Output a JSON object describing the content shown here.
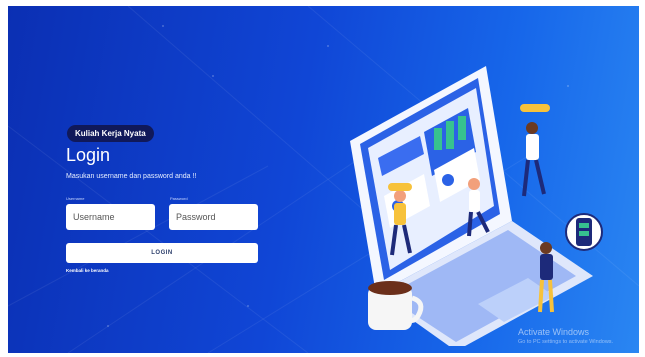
{
  "badge": "Kuliah Kerja Nyata",
  "title": "Login",
  "subtitle": "Masukan username dan password anda !!",
  "form": {
    "username_label": "Username",
    "username_placeholder": "Username",
    "password_label": "Password",
    "password_placeholder": "Password",
    "login_button": "LOGIN"
  },
  "back_link": "Kembali ke beranda",
  "watermark": {
    "title": "Activate Windows",
    "subtitle": "Go to PC settings to activate Windows."
  },
  "colors": {
    "bg_start": "#0b2fb3",
    "bg_end": "#2a86f2",
    "badge_bg": "#10195a"
  }
}
